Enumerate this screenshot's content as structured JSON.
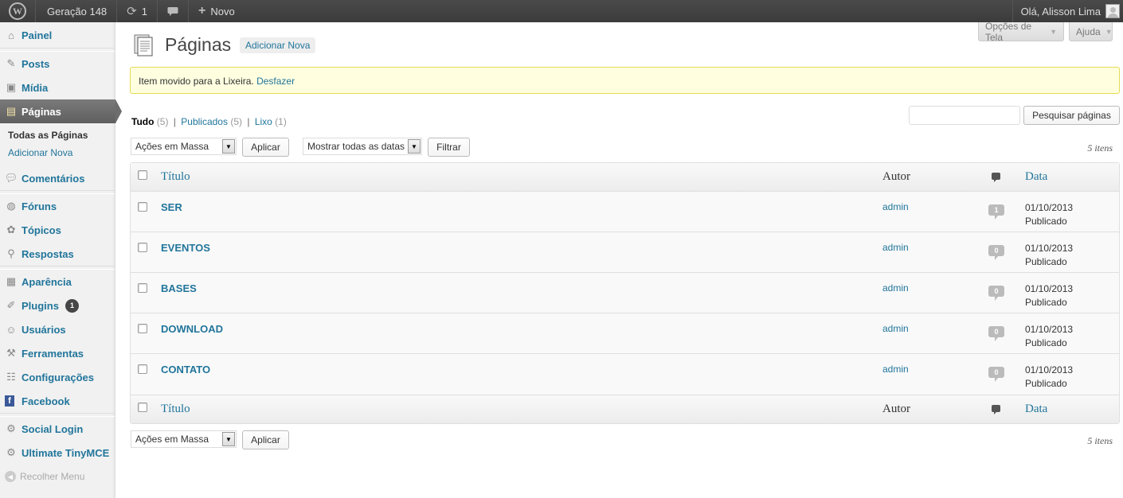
{
  "adminbar": {
    "logo": "wp-logo-icon",
    "site_name": "Geração 148",
    "updates_count": "1",
    "updates_icon": "refresh-icon",
    "comments_icon": "comment-icon",
    "new_label": "Novo",
    "greeting": "Olá, Alisson Lima"
  },
  "sidebar": {
    "items": [
      {
        "label": "Painel",
        "icon": "home-icon"
      },
      {
        "label": "Posts",
        "icon": "pin-icon"
      },
      {
        "label": "Mídia",
        "icon": "media-icon"
      },
      {
        "label": "Páginas",
        "icon": "pages-icon"
      },
      {
        "label": "Comentários",
        "icon": "comment-icon"
      },
      {
        "label": "Fóruns",
        "icon": "forum-icon"
      },
      {
        "label": "Tópicos",
        "icon": "topics-icon"
      },
      {
        "label": "Respostas",
        "icon": "replies-icon"
      },
      {
        "label": "Aparência",
        "icon": "appearance-icon"
      },
      {
        "label": "Plugins",
        "icon": "plugin-icon"
      },
      {
        "label": "Usuários",
        "icon": "users-icon"
      },
      {
        "label": "Ferramentas",
        "icon": "tools-icon"
      },
      {
        "label": "Configurações",
        "icon": "settings-icon"
      },
      {
        "label": "Facebook",
        "icon": "facebook-icon"
      },
      {
        "label": "Social Login",
        "icon": "gear-icon"
      },
      {
        "label": "Ultimate TinyMCE",
        "icon": "gear-icon"
      }
    ],
    "submenu": {
      "all_pages": "Todas as Páginas",
      "add_new": "Adicionar Nova"
    },
    "plugins_badge": "1",
    "collapse_label": "Recolher Menu"
  },
  "screen_meta": {
    "options": "Opções de Tela",
    "help": "Ajuda"
  },
  "page": {
    "title": "Páginas",
    "add_new": "Adicionar Nova"
  },
  "notice": {
    "text": "Item movido para a Lixeira.",
    "undo": "Desfazer"
  },
  "views": {
    "all": "Tudo",
    "all_count": "(5)",
    "published": "Publicados",
    "published_count": "(5)",
    "trash": "Lixo",
    "trash_count": "(1)",
    "sep": "|"
  },
  "search": {
    "button": "Pesquisar páginas"
  },
  "tablenav": {
    "bulk_actions": "Ações em Massa",
    "apply": "Aplicar",
    "dates": "Mostrar todas as datas",
    "filter": "Filtrar",
    "displaying": "5 itens"
  },
  "table": {
    "columns": {
      "title": "Título",
      "author": "Autor",
      "date": "Data"
    },
    "rows": [
      {
        "title": "SER",
        "author": "admin",
        "comments": "1",
        "date": "01/10/2013",
        "status": "Publicado"
      },
      {
        "title": "EVENTOS",
        "author": "admin",
        "comments": "0",
        "date": "01/10/2013",
        "status": "Publicado"
      },
      {
        "title": "BASES",
        "author": "admin",
        "comments": "0",
        "date": "01/10/2013",
        "status": "Publicado"
      },
      {
        "title": "DOWNLOAD",
        "author": "admin",
        "comments": "0",
        "date": "01/10/2013",
        "status": "Publicado"
      },
      {
        "title": "CONTATO",
        "author": "admin",
        "comments": "0",
        "date": "01/10/2013",
        "status": "Publicado"
      }
    ]
  },
  "colors": {
    "link": "#21759b",
    "adminbar": "#464646",
    "notice_bg": "#ffffe0",
    "notice_border": "#e6db55"
  }
}
